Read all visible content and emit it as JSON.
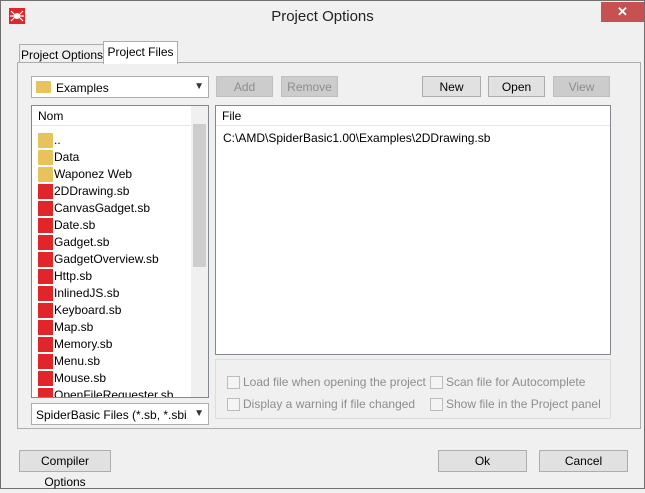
{
  "window": {
    "title": "Project Options",
    "close_glyph": "✕"
  },
  "tabs": [
    {
      "label": "Project Options",
      "active": false
    },
    {
      "label": "Project Files",
      "active": true
    }
  ],
  "folder_combo": {
    "value": "Examples"
  },
  "buttons": {
    "add": "Add",
    "remove": "Remove",
    "new": "New",
    "open": "Open",
    "view": "View",
    "compiler_options": "Compiler Options",
    "ok": "Ok",
    "cancel": "Cancel"
  },
  "browser": {
    "header": "Nom",
    "items": [
      {
        "name": "..",
        "type": "folder"
      },
      {
        "name": "Data",
        "type": "folder"
      },
      {
        "name": "Waponez Web",
        "type": "folder"
      },
      {
        "name": "2DDrawing.sb",
        "type": "file"
      },
      {
        "name": "CanvasGadget.sb",
        "type": "file"
      },
      {
        "name": "Date.sb",
        "type": "file"
      },
      {
        "name": "Gadget.sb",
        "type": "file"
      },
      {
        "name": "GadgetOverview.sb",
        "type": "file"
      },
      {
        "name": "Http.sb",
        "type": "file"
      },
      {
        "name": "InlinedJS.sb",
        "type": "file"
      },
      {
        "name": "Keyboard.sb",
        "type": "file"
      },
      {
        "name": "Map.sb",
        "type": "file"
      },
      {
        "name": "Memory.sb",
        "type": "file"
      },
      {
        "name": "Menu.sb",
        "type": "file"
      },
      {
        "name": "Mouse.sb",
        "type": "file"
      },
      {
        "name": "OpenFileRequester.sb",
        "type": "file"
      }
    ]
  },
  "filter_combo": {
    "value": "SpiderBasic Files (*.sb, *.sbi, *.sb"
  },
  "project_files": {
    "header": "File",
    "items": [
      "C:\\AMD\\SpiderBasic1.00\\Examples\\2DDrawing.sb"
    ]
  },
  "file_options": {
    "load_on_open": "Load file when opening the project",
    "warn_changed": "Display a warning if file changed",
    "scan_autocomplete": "Scan file for Autocomplete",
    "show_in_panel": "Show file in the Project panel"
  },
  "icons": {
    "app": "spider-icon",
    "folder": "folder-icon",
    "file": "spiderbasic-file-icon"
  },
  "colors": {
    "close_button": "#c75050",
    "file_icon": "#e0262b",
    "folder_icon": "#e8c25a"
  }
}
